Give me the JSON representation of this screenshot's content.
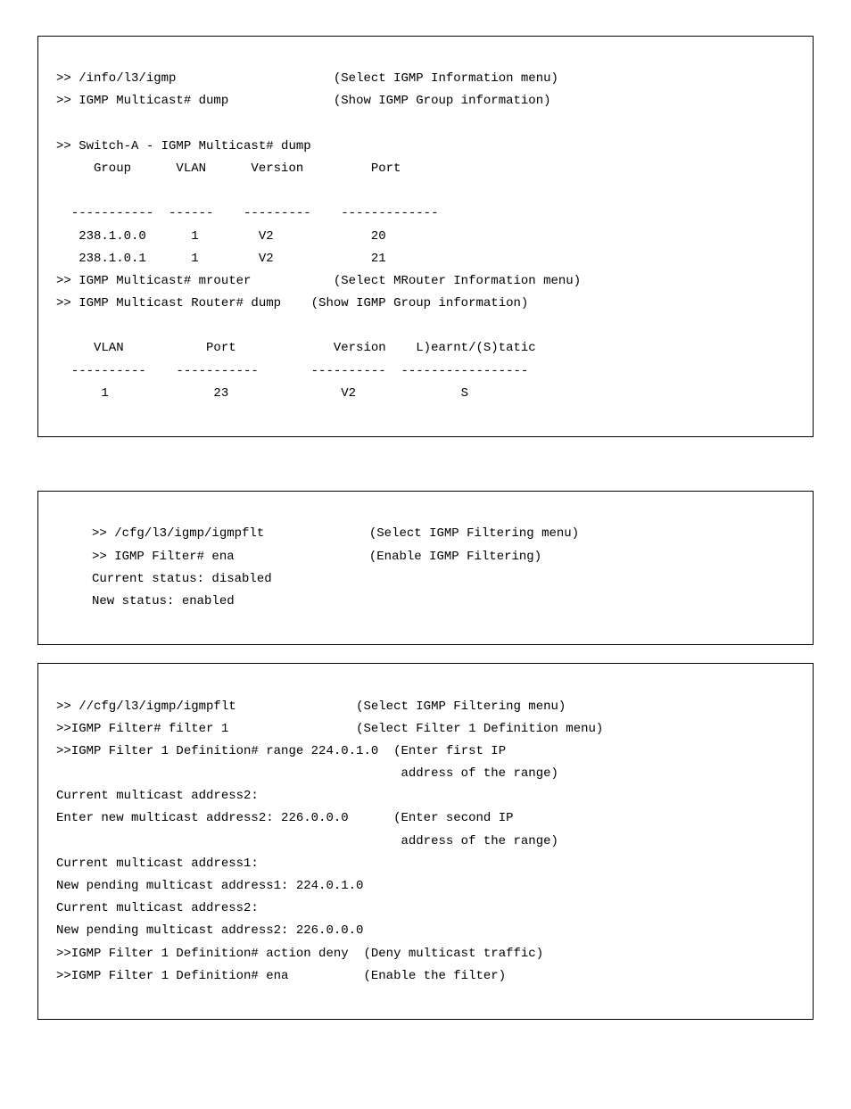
{
  "box1": {
    "l1_left": ">> /info/l3/igmp",
    "l1_right": "(Select IGMP Information menu)",
    "l2_left": ">> IGMP Multicast# dump",
    "l2_right": "(Show IGMP Group information)",
    "blank1": " ",
    "l3": ">> Switch-A - IGMP Multicast# dump",
    "l4": "     Group      VLAN      Version         Port",
    "blank2": " ",
    "l5": "  -----------  ------    ---------    -------------",
    "l6": "   238.1.0.0      1        V2             20",
    "l7": "   238.1.0.1      1        V2             21",
    "l8_left": ">> IGMP Multicast# mrouter",
    "l8_right": "(Select MRouter Information menu)",
    "l9_left": ">> IGMP Multicast Router# dump",
    "l9_right": "(Show IGMP Group information)",
    "blank3": " ",
    "l10": "     VLAN           Port             Version    L)earnt/(S)tatic",
    "l11": "  ----------    -----------       ----------  -----------------",
    "l12": "      1              23               V2              S"
  },
  "box2": {
    "l1_left": ">> /cfg/l3/igmp/igmpflt",
    "l1_right": "(Select IGMP Filtering menu)",
    "l2_left": ">> IGMP Filter# ena",
    "l2_right": "(Enable IGMP Filtering)",
    "l3": "Current status: disabled",
    "l4": "New status: enabled"
  },
  "box3": {
    "l1_left": ">> //cfg/l3/igmp/igmpflt",
    "l1_right": "(Select IGMP Filtering menu)",
    "l2_left": ">>IGMP Filter# filter 1",
    "l2_right": "(Select Filter 1 Definition menu)",
    "l3_left": ">>IGMP Filter 1 Definition# range 224.0.1.0",
    "l3_right": "(Enter first IP",
    "l3b_right": "address of the range)",
    "l4": "Current multicast address2:",
    "l5_left": "Enter new multicast address2: 226.0.0.0",
    "l5_right": "(Enter second IP",
    "l5b_right": "address of the range)",
    "l6": "Current multicast address1:",
    "l7": "New pending multicast address1: 224.0.1.0",
    "l8": "Current multicast address2:",
    "l9": "New pending multicast address2: 226.0.0.0",
    "l10_left": ">>IGMP Filter 1 Definition# action deny",
    "l10_right": "(Deny multicast traffic)",
    "l11_left": ">>IGMP Filter 1 Definition# ena",
    "l11_right": "(Enable the filter)"
  }
}
